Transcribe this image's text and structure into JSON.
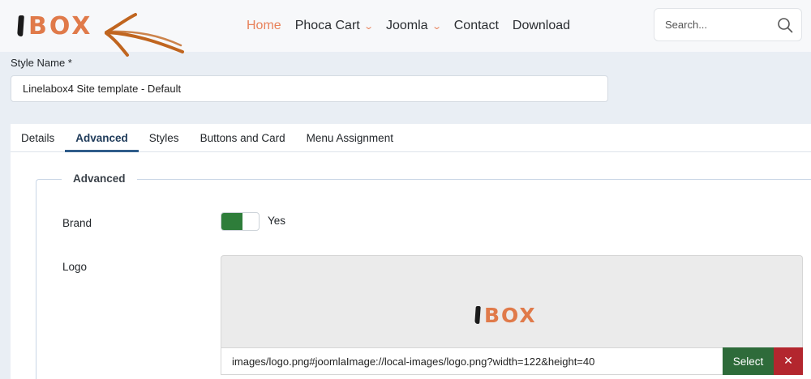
{
  "header": {
    "logo_text": "BOX",
    "nav": [
      {
        "label": "Home",
        "active": true,
        "has_dropdown": false
      },
      {
        "label": "Phoca Cart",
        "active": false,
        "has_dropdown": true
      },
      {
        "label": "Joomla",
        "active": false,
        "has_dropdown": true
      },
      {
        "label": "Contact",
        "active": false,
        "has_dropdown": false
      },
      {
        "label": "Download",
        "active": false,
        "has_dropdown": false
      }
    ],
    "search": {
      "placeholder": "Search...",
      "value": ""
    },
    "dropdown_glyph": "❯"
  },
  "form": {
    "style_name_label": "Style Name *",
    "style_name_value": "Linelabox4 Site template - Default",
    "tabs": [
      {
        "label": "Details",
        "active": false
      },
      {
        "label": "Advanced",
        "active": true
      },
      {
        "label": "Styles",
        "active": false
      },
      {
        "label": "Buttons and Card",
        "active": false
      },
      {
        "label": "Menu Assignment",
        "active": false
      }
    ],
    "fieldset_legend": "Advanced",
    "brand_label": "Brand",
    "brand_value": "Yes",
    "logo_label": "Logo",
    "logo_preview_text": "BOX",
    "logo_path": "images/logo.png#joomlaImage://local-images/logo.png?width=122&height=40",
    "select_label": "Select",
    "clear_label": "✕"
  },
  "colors": {
    "accent": "#e8815a",
    "switch_on": "#2e7d3a",
    "select_button": "#2e6b3a",
    "clear_button": "#b3262e",
    "arrow": "#c0651f"
  }
}
